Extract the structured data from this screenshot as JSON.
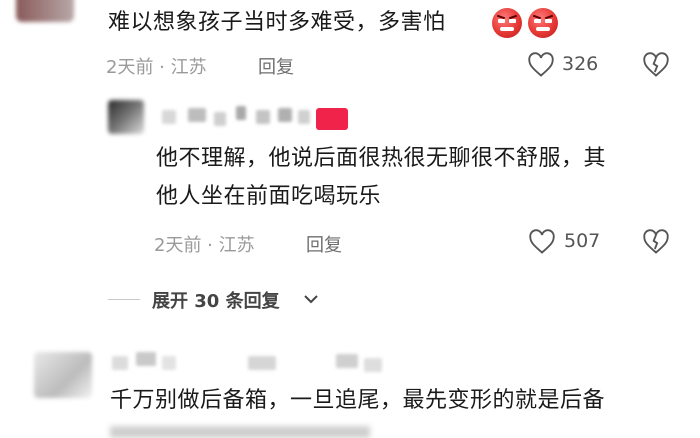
{
  "comments": [
    {
      "text": "难以想象孩子当时多难受，多害怕",
      "emoji_names": [
        "angry-face-icon",
        "angry-face-icon"
      ],
      "time_location": "2天前 · 江苏",
      "reply_label": "回复",
      "like_count": "326"
    },
    {
      "text_line1": "他不理解，他说后面很热很无聊很不舒服，其",
      "text_line2": "他人坐在前面吃喝玩乐",
      "time_location": "2天前 · 江苏",
      "reply_label": "回复",
      "like_count": "507"
    },
    {
      "text": "千万别做后备箱，一旦追尾，最先变形的就是后备"
    }
  ],
  "expand_replies_label": "展开 30 条回复",
  "colors": {
    "accent_red": "#f0244a",
    "meta_gray": "#9a9a9a"
  }
}
